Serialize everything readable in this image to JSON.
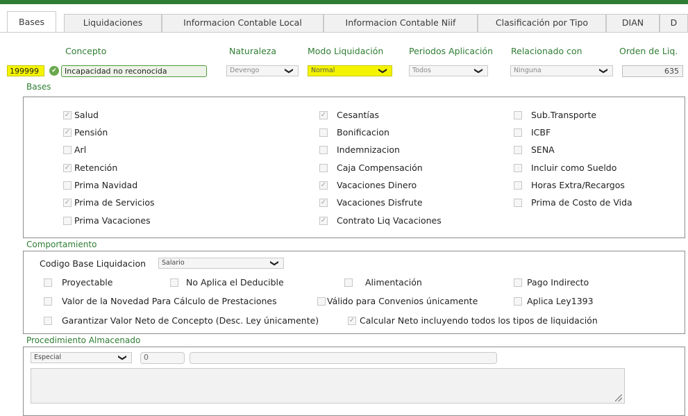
{
  "tabs": [
    "Bases",
    "Liquidaciones",
    "Informacion Contable Local",
    "Informacion Contable Niif",
    "Clasificación por Tipo",
    "DIAN",
    "D"
  ],
  "header": {
    "concepto_label": "Concepto",
    "naturaleza_label": "Naturaleza",
    "modo_label": "Modo Liquidación",
    "periodos_label": "Periodos Aplicación",
    "relacionado_label": "Relacionado con",
    "orden_label": "Orden de Liq."
  },
  "fields": {
    "code": "199999",
    "concept": "Incapacidad no reconocida",
    "naturaleza": "Devengo",
    "modo": "Normal",
    "periodos": "Todos",
    "relacionado": "Ninguna",
    "orden": "635"
  },
  "bases": {
    "title": "Bases",
    "col1": [
      {
        "label": "Salud",
        "checked": true
      },
      {
        "label": "Pensión",
        "checked": true
      },
      {
        "label": "Arl",
        "checked": false
      },
      {
        "label": "Retención",
        "checked": true
      },
      {
        "label": "Prima Navidad",
        "checked": false
      },
      {
        "label": "Prima de Servicios",
        "checked": true
      },
      {
        "label": "Prima Vacaciones",
        "checked": false
      }
    ],
    "col2": [
      {
        "label": "Cesantías",
        "checked": true
      },
      {
        "label": "Bonificacion",
        "checked": false
      },
      {
        "label": "Indemnizacion",
        "checked": false
      },
      {
        "label": "Caja Compensación",
        "checked": false
      },
      {
        "label": "Vacaciones Dinero",
        "checked": true
      },
      {
        "label": "Vacaciones Disfrute",
        "checked": true
      },
      {
        "label": "Contrato Liq Vacaciones",
        "checked": true
      }
    ],
    "col3": [
      {
        "label": "Sub.Transporte",
        "checked": false
      },
      {
        "label": "ICBF",
        "checked": false
      },
      {
        "label": "SENA",
        "checked": false
      },
      {
        "label": "Incluir como Sueldo",
        "checked": false
      },
      {
        "label": "Horas Extra/Recargos",
        "checked": false
      },
      {
        "label": "Prima de Costo de Vida",
        "checked": false
      }
    ]
  },
  "comportamiento": {
    "title": "Comportamiento",
    "codigo_label": "Codigo Base Liquidacion",
    "codigo_value": "Salario",
    "proyectable": "Proyectable",
    "no_aplica": "No Aplica el Deducible",
    "alimentacion": "Alimentación",
    "pago_indirecto": "Pago Indirecto",
    "valor_novedad": "Valor de la Novedad Para Cálculo de Prestaciones",
    "valido_convenios": "Válido para Convenios únicamente",
    "aplica_ley": "Aplica Ley1393",
    "garantizar": "Garantizar Valor Neto de Concepto (Desc. Ley únicamente)",
    "calcular_neto": "Calcular Neto incluyendo todos los tipos de liquidación",
    "calcular_neto_checked": true
  },
  "procedimiento": {
    "title": "Procedimiento Almacenado",
    "tipo": "Especial",
    "numero": "0",
    "nombre": ""
  },
  "glyphs": {
    "check": "✓",
    "chevron": "❯",
    "ok": "✔"
  }
}
